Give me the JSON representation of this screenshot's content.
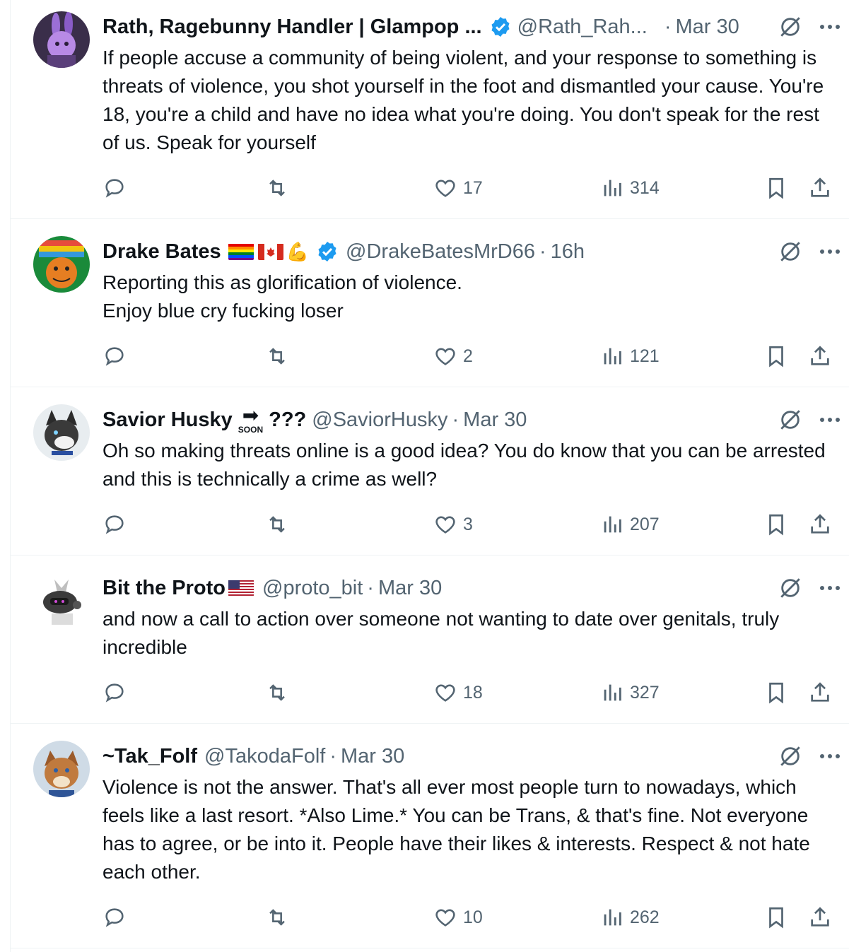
{
  "colors": {
    "accent": "#1d9bf0",
    "text": "#0f1419",
    "muted": "#536471",
    "border": "#eff3f4"
  },
  "tweets": [
    {
      "name": "Rath, Ragebunny Handler | Glampop ...",
      "verified": true,
      "handle": "@Rath_Rah...",
      "separator": "·",
      "time": "Mar 30",
      "text": "If people accuse a community of being violent, and your response to something is threats of violence, you shot yourself in the foot and dismantled your cause. You're 18, you're a child and have no idea what you're doing. You don't speak for the rest of us. Speak for yourself",
      "likes": "17",
      "views": "314"
    },
    {
      "name": "Drake Bates",
      "emoji": [
        "rainbow-flag",
        "canada-flag",
        "flexed-bicep"
      ],
      "bicep": "💪",
      "verified": true,
      "handle": "@DrakeBatesMrD66",
      "separator": "·",
      "time": "16h",
      "text": "Reporting this as glorification of violence.\nEnjoy blue cry fucking loser",
      "likes": "2",
      "views": "121"
    },
    {
      "name": "Savior Husky",
      "soon_arrow": "➡",
      "soon_label": "SOON",
      "suffix": "???",
      "handle": "@SaviorHusky",
      "separator": "·",
      "time": "Mar 30",
      "text": "Oh so making threats online is a good idea? You do know that you can be arrested and this is technically a crime as well?",
      "likes": "3",
      "views": "207"
    },
    {
      "name": "Bit the Proto",
      "emoji": [
        "us-flag"
      ],
      "handle": "@proto_bit",
      "separator": "·",
      "time": "Mar 30",
      "text": "and now a call to action over someone not wanting to date over genitals, truly incredible",
      "likes": "18",
      "views": "327"
    },
    {
      "name": "~Tak_Folf",
      "handle": "@TakodaFolf",
      "separator": "·",
      "time": "Mar 30",
      "text": "Violence is not the answer. That's all ever most people turn to nowadays, which feels like a last resort. *Also Lime.* You can be Trans, & that's fine. Not everyone has to agree, or be into it. People have their likes & interests. Respect & not hate each other.",
      "likes": "10",
      "views": "262"
    }
  ]
}
